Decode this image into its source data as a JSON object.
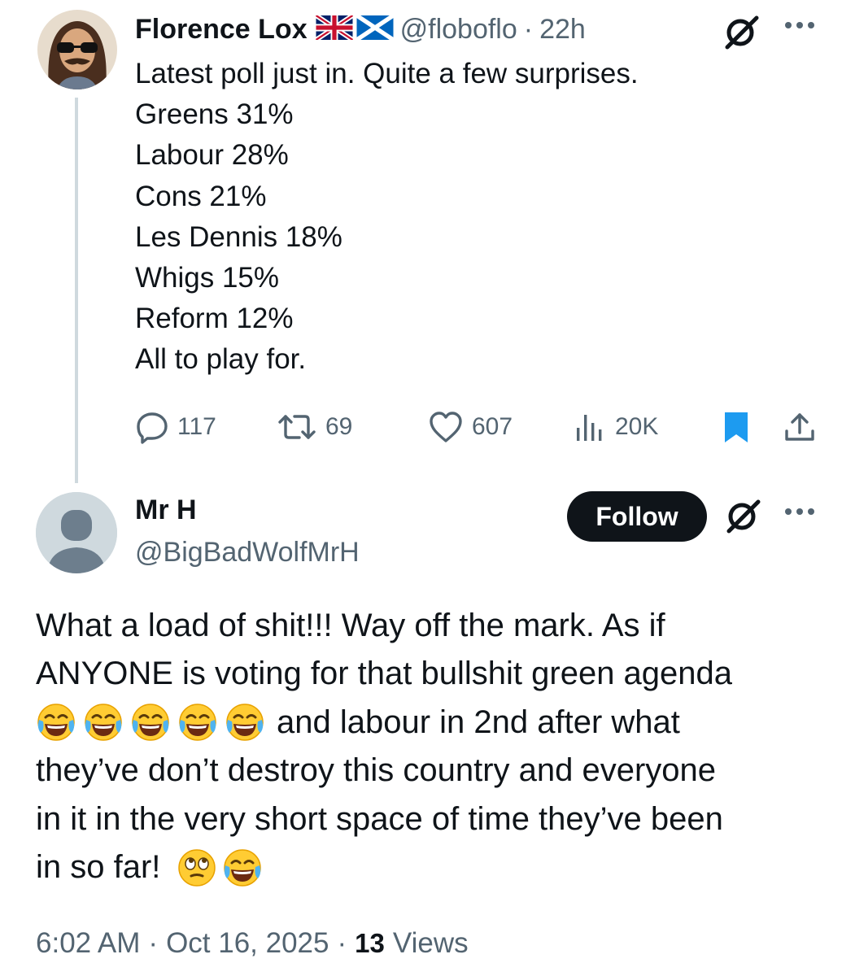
{
  "tweet1": {
    "author_name": "Florence Lox",
    "handle": "@floboflo",
    "separator": "·",
    "time": "22h",
    "lines": [
      "Latest poll just in. Quite a few surprises.",
      "Greens 31%",
      "Labour 28%",
      "Cons 21%",
      "Les Dennis 18%",
      "Whigs 15%",
      "Reform 12%",
      "All to play for."
    ],
    "actions": {
      "replies": "117",
      "reposts": "69",
      "likes": "607",
      "views": "20K"
    }
  },
  "tweet2": {
    "author_name": "Mr H",
    "handle": "@BigBadWolfMrH",
    "follow_label": "Follow",
    "body_lines": [
      "What a load of shit!!! Way off the mark. As if",
      "ANYONE is voting for that bullshit green agenda",
      "and labour in 2nd after what",
      "they’ve don’t destroy this country and everyone",
      "in it in the very short space of time they’ve been",
      "in so far!"
    ],
    "meta": {
      "time": "6:02 AM",
      "sep1": "·",
      "date": "Oct 16, 2025",
      "sep2": "·",
      "views_count": "13",
      "views_label": "Views"
    }
  },
  "icons": {
    "emoji_laugh": "face-with-tears-of-joy",
    "emoji_eyeroll": "face-with-rolling-eyes",
    "flags": [
      "united-kingdom-flag",
      "scotland-flag"
    ]
  },
  "colors": {
    "text": "#0f1419",
    "secondary": "#536471",
    "bookmark_active": "#1d9bf0",
    "follow_bg": "#0f1419",
    "thread_line": "#cfd9de"
  }
}
